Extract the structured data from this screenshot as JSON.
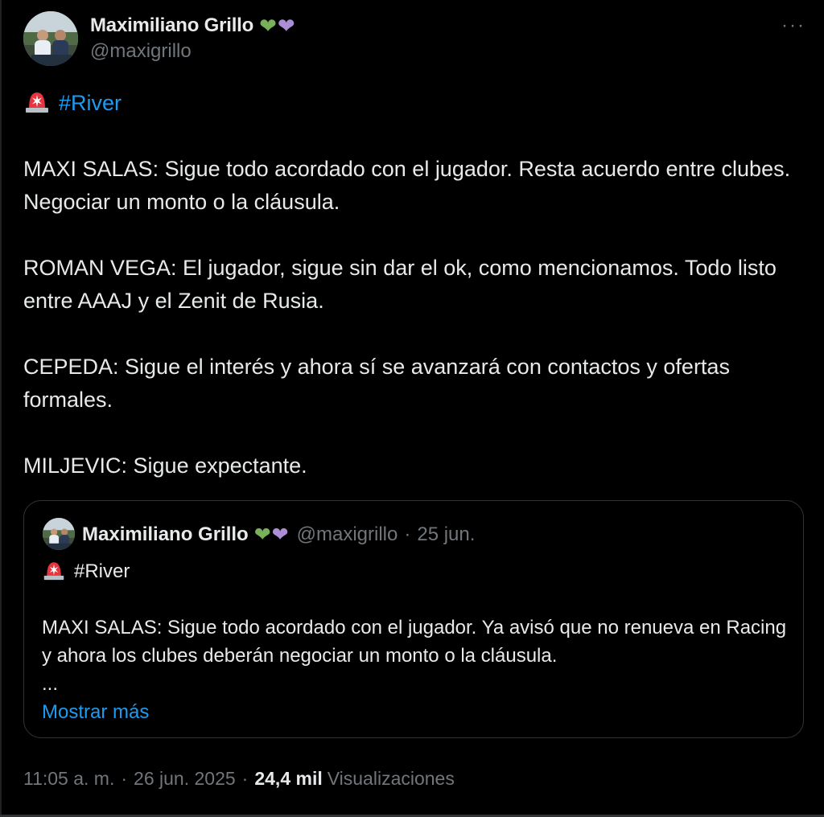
{
  "author": {
    "display_name": "Maximiliano Grillo",
    "handle": "@maxigrillo",
    "badges": [
      "green-heart-icon",
      "purple-heart-icon"
    ]
  },
  "tweet": {
    "hashtag": "#River",
    "paragraphs": [
      "MAXI SALAS: Sigue todo acordado con el jugador. Resta acuerdo entre clubes. Negociar un monto o la cláusula.",
      "ROMAN VEGA: El jugador, sigue sin dar el ok, como mencionamos. Todo listo entre AAAJ y el Zenit de Rusia.",
      "CEPEDA: Sigue el interés y ahora sí se avanzará con contactos y ofertas formales.",
      "MILJEVIC: Sigue expectante."
    ]
  },
  "quote": {
    "display_name": "Maximiliano Grillo",
    "handle": "@maxigrillo",
    "separator": "·",
    "date": "25 jun.",
    "hashtag": "#River",
    "text": "MAXI SALAS: Sigue todo acordado con el jugador. Ya avisó que no renueva en Racing y ahora los clubes deberán negociar un monto o la cláusula.",
    "ellipsis": "...",
    "show_more": "Mostrar más"
  },
  "footer": {
    "time": "11:05 a. m.",
    "separator": "·",
    "date": "26 jun. 2025",
    "separator2": "·",
    "views_count": "24,4 mil",
    "views_label": "Visualizaciones"
  },
  "icons": {
    "more": "more-options-icon",
    "siren": "siren-icon"
  },
  "colors": {
    "background": "#000000",
    "text": "#e7e9ea",
    "muted": "#71767b",
    "link": "#1d9bf0",
    "border": "#2f3336"
  }
}
